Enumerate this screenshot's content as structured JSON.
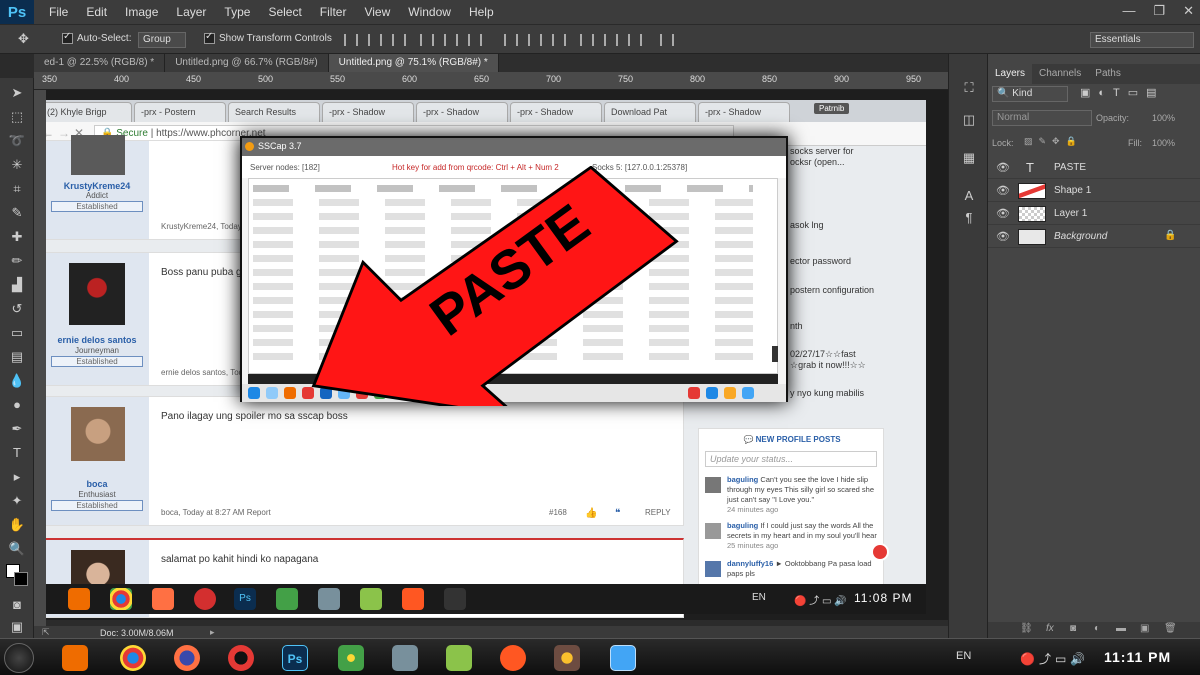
{
  "menubar": {
    "logo": "Ps",
    "items": [
      "File",
      "Edit",
      "Image",
      "Layer",
      "Type",
      "Select",
      "Filter",
      "View",
      "Window",
      "Help"
    ]
  },
  "options": {
    "auto_select": "Auto-Select:",
    "group": "Group",
    "show_transform": "Show Transform Controls",
    "workspace": "Essentials"
  },
  "doc_tabs": [
    "ed-1 @ 22.5% (RGB/8) *",
    "Untitled.png @ 66.7% (RGB/8#)",
    "Untitled.png @ 75.1% (RGB/8#) *"
  ],
  "ruler_marks": [
    "350",
    "400",
    "450",
    "500",
    "550",
    "600",
    "650",
    "700",
    "750",
    "800",
    "850",
    "900",
    "950"
  ],
  "browser": {
    "tabs": [
      "(2) Khyle Brigp",
      "-prx - Postern",
      "Search Results",
      "-prx - Shadow",
      "-prx - Shadow",
      "-prx - Shadow",
      "Download Pat",
      "-prx - Shadow"
    ],
    "profile_badge": "Patrnib",
    "secure": "Secure",
    "url": "https://www.phcorner.net"
  },
  "posts": [
    {
      "user": "KrustyKreme24",
      "rank": "Addict",
      "badge": "Established",
      "message": "",
      "meta": "KrustyKreme24, Today at"
    },
    {
      "user": "ernie delos santos",
      "rank": "Journeyman",
      "badge": "Established",
      "message": "Boss panu puba gu",
      "meta": "ernie delos santos, Today"
    },
    {
      "user": "boca",
      "rank": "Enthusiast",
      "badge": "Established",
      "message": "Pano ilagay ung spoiler mo sa sscap boss",
      "meta": "boca, Today at 8:27 AM   Report",
      "postno": "#168",
      "reply": "REPLY"
    },
    {
      "user": "",
      "rank": "",
      "badge": "",
      "message": "salamat po kahit hindi ko napagana",
      "meta": ""
    }
  ],
  "right_col": {
    "snippets": [
      "socks server for",
      "ocksr (open...",
      "asok lng",
      "ector password",
      "postern configuration",
      "nth",
      "02/27/17☆☆fast",
      "☆grab it now!!!☆☆",
      "y nyo kung mabilis"
    ],
    "profile_posts_title": "NEW PROFILE POSTS",
    "status_placeholder": "Update your status...",
    "items": [
      {
        "name": "baguling",
        "text": "Can't you see the love I hide slip through my eyes This silly girl so scared she just can't say \"I Love you.\"",
        "time": "24 minutes ago"
      },
      {
        "name": "baguling",
        "text": "If I could just say the words All the secrets in my heart and in my soul you'll hear",
        "time": "25 minutes ago"
      },
      {
        "name": "dannyluffy16",
        "text": "► Ooktobbang Pa pasa load paps pls",
        "time": ""
      }
    ]
  },
  "sscap": {
    "title": "SSCap 3.7",
    "server_nodes": "Server nodes: [182]",
    "hotkey": "Hot key for add from qrcode: Ctrl + Alt + Num 2",
    "socks": "Socks 5: [127.0.0.1:25378]"
  },
  "overlay": {
    "label": "PASTE"
  },
  "inner_taskbar": {
    "lang": "EN",
    "time": "11:08 PM"
  },
  "status": {
    "doc": "Doc: 3.00M/8.06M"
  },
  "layers_panel": {
    "tabs": [
      "Layers",
      "Channels",
      "Paths"
    ],
    "kind": "Kind",
    "blend": "Normal",
    "opacity_label": "Opacity:",
    "opacity": "100%",
    "lock_label": "Lock:",
    "fill_label": "Fill:",
    "fill": "100%",
    "layers": [
      {
        "name": "PASTE",
        "type": "text"
      },
      {
        "name": "Shape 1",
        "type": "shape"
      },
      {
        "name": "Layer 1",
        "type": "pixel"
      },
      {
        "name": "Background",
        "type": "background"
      }
    ]
  },
  "win_taskbar": {
    "lang": "EN",
    "time": "11:11 PM"
  }
}
